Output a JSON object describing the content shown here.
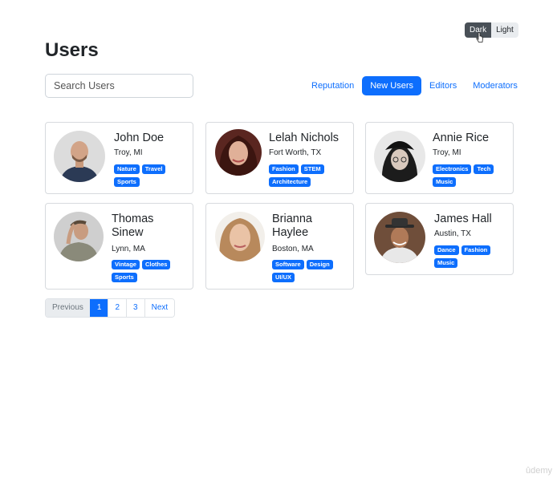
{
  "theme_toggle": {
    "dark_label": "Dark",
    "light_label": "Light"
  },
  "page_title": "Users",
  "search": {
    "placeholder": "Search Users",
    "value": ""
  },
  "tabs": [
    {
      "label": "Reputation",
      "active": false
    },
    {
      "label": "New Users",
      "active": true
    },
    {
      "label": "Editors",
      "active": false
    },
    {
      "label": "Moderators",
      "active": false
    }
  ],
  "users": [
    {
      "name": "John Doe",
      "location": "Troy, MI",
      "tags": [
        "Nature",
        "Travel",
        "Sports"
      ]
    },
    {
      "name": "Lelah Nichols",
      "location": "Fort Worth, TX",
      "tags": [
        "Fashion",
        "STEM",
        "Architecture"
      ]
    },
    {
      "name": "Annie Rice",
      "location": "Troy, MI",
      "tags": [
        "Electronics",
        "Tech",
        "Music"
      ]
    },
    {
      "name": "Thomas Sinew",
      "location": "Lynn, MA",
      "tags": [
        "Vintage",
        "Clothes",
        "Sports"
      ]
    },
    {
      "name": "Brianna Haylee",
      "location": "Boston, MA",
      "tags": [
        "Software",
        "Design",
        "UI/UX"
      ]
    },
    {
      "name": "James Hall",
      "location": "Austin, TX",
      "tags": [
        "Dance",
        "Fashion",
        "Music"
      ]
    }
  ],
  "pagination": {
    "previous": "Previous",
    "pages": [
      "1",
      "2",
      "3"
    ],
    "active_page": "1",
    "next": "Next"
  },
  "watermark": "ûdemy",
  "colors": {
    "primary": "#0d6efd",
    "dark_toggle": "#495057",
    "light_toggle": "#e9ecef",
    "border": "#d7dade"
  }
}
